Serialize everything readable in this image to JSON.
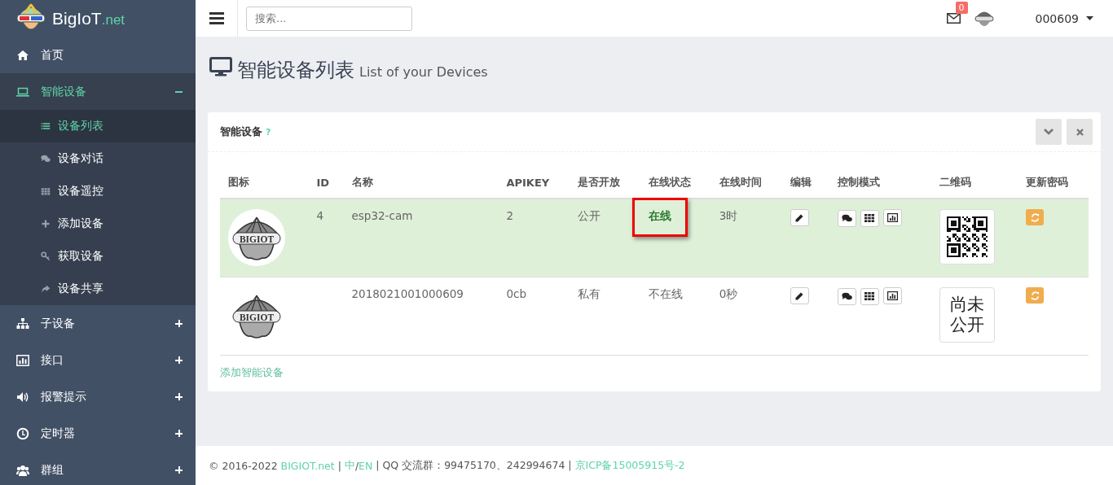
{
  "brand": {
    "name": "BigIoT",
    "suffix": ".net"
  },
  "search": {
    "placeholder": "搜索..."
  },
  "header": {
    "mail_count": "0",
    "user": "000609"
  },
  "sidebar": {
    "items": [
      {
        "label": "首页"
      },
      {
        "label": "智能设备",
        "expanded": true,
        "children": [
          {
            "label": "设备列表",
            "selected": true
          },
          {
            "label": "设备对话",
            "selected": false
          },
          {
            "label": "设备遥控",
            "selected": false
          },
          {
            "label": "添加设备",
            "selected": false
          },
          {
            "label": "获取设备",
            "selected": false
          },
          {
            "label": "设备共享",
            "selected": false
          }
        ]
      },
      {
        "label": "子设备",
        "expanded": false
      },
      {
        "label": "接口",
        "expanded": false
      },
      {
        "label": "报警提示",
        "expanded": false
      },
      {
        "label": "定时器",
        "expanded": false
      },
      {
        "label": "群组",
        "expanded": false
      }
    ]
  },
  "page": {
    "title": "智能设备列表",
    "subtitle": "List of your Devices"
  },
  "panel": {
    "title": "智能设备",
    "help": "?",
    "columns": [
      "图标",
      "ID",
      "名称",
      "APIKEY",
      "是否开放",
      "在线状态",
      "在线时间",
      "编辑",
      "控制模式",
      "二维码",
      "更新密码"
    ],
    "rows": [
      {
        "logo_text": "BIGIOT",
        "id": "4",
        "name": "esp32-cam",
        "apikey": "2",
        "public": "公开",
        "status": "在线",
        "online": true,
        "time": "3时"
      },
      {
        "logo_text": "BIGIOT",
        "name": "2018021001000609",
        "apikey": "0cb",
        "public": "私有",
        "status": "不在线",
        "online": false,
        "time": "0秒",
        "qr_text": "尚未公开"
      }
    ],
    "add_link": "添加智能设备"
  },
  "footer": {
    "parts": [
      {
        "kind": "text",
        "text": "© 2016-2022 "
      },
      {
        "kind": "link",
        "text": "BIGIOT.net"
      },
      {
        "kind": "text",
        "text": " | "
      },
      {
        "kind": "link",
        "text": "中"
      },
      {
        "kind": "text",
        "text": "/"
      },
      {
        "kind": "link",
        "text": "EN"
      },
      {
        "kind": "text",
        "text": " | QQ 交流群：99475170、242994674 | "
      },
      {
        "kind": "link",
        "text": "京ICP备15005915号-2"
      }
    ]
  }
}
